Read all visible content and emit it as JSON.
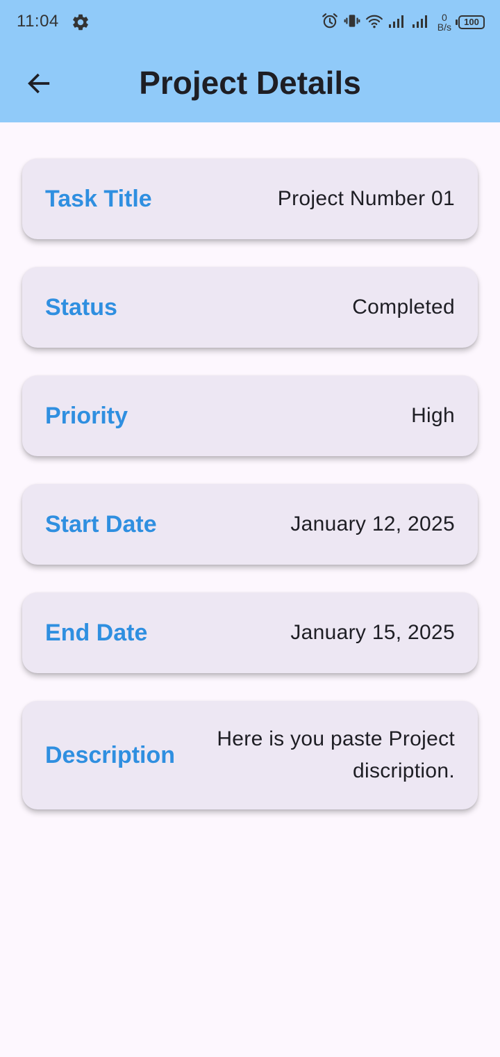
{
  "status_bar": {
    "time": "11:04",
    "net_speed_value": "0",
    "net_speed_unit": "B/s",
    "battery": "100"
  },
  "header": {
    "title": "Project Details",
    "background": "#90caf9"
  },
  "details": [
    {
      "label": "Task Title",
      "value": "Project Number 01"
    },
    {
      "label": "Status",
      "value": "Completed"
    },
    {
      "label": "Priority",
      "value": "High"
    },
    {
      "label": "Start Date",
      "value": "January 12, 2025"
    },
    {
      "label": "End Date",
      "value": "January 15, 2025"
    },
    {
      "label": "Description",
      "value": "Here is you paste Project discription."
    }
  ],
  "colors": {
    "accent": "#2f8fe0",
    "card_background": "#ede7f3",
    "page_background": "#fdf7fe"
  },
  "icons": {
    "back": "arrow-left-icon",
    "settings": "gear-icon",
    "alarm": "alarm-icon",
    "vibrate": "vibrate-icon",
    "wifi": "wifi-icon",
    "signal": "signal-icon",
    "battery": "battery-icon"
  }
}
